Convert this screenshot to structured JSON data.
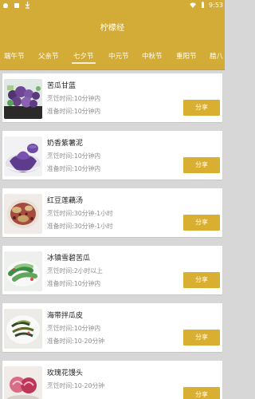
{
  "status_bar": {
    "time": "9:53"
  },
  "app": {
    "title": "柠檬经"
  },
  "tabs": [
    {
      "label": "端午节"
    },
    {
      "label": "父亲节"
    },
    {
      "label": "七夕节",
      "active": true
    },
    {
      "label": "中元节"
    },
    {
      "label": "中秋节"
    },
    {
      "label": "重阳节"
    },
    {
      "label": "腊八"
    }
  ],
  "recipes": [
    {
      "title": "苦瓜甘蓝",
      "cook_time": "烹饪时间:10分钟内",
      "prep_time": "准备时间:10分钟内",
      "share_label": "分享",
      "thumb_icon": "purple-cauliflower-photo"
    },
    {
      "title": "奶香紫薯泥",
      "cook_time": "烹饪时间:10分钟内",
      "prep_time": "准备时间:10分钟内",
      "share_label": "分享",
      "thumb_icon": "purple-mashed-potato-photo"
    },
    {
      "title": "红豆莲藕汤",
      "cook_time": "烹饪时间:30分钟-1小时",
      "prep_time": "准备时间:30分钟-1小时",
      "share_label": "分享",
      "thumb_icon": "red-bean-lotus-soup-photo"
    },
    {
      "title": "冰镇雪碧苦瓜",
      "cook_time": "烹饪时间:2小时以上",
      "prep_time": "准备时间:10分钟内",
      "share_label": "分享",
      "thumb_icon": "bitter-melon-photo"
    },
    {
      "title": "海带拌瓜皮",
      "cook_time": "烹饪时间:10分钟内",
      "prep_time": "准备时间:10-20分钟",
      "share_label": "分享",
      "thumb_icon": "kelp-salad-photo"
    },
    {
      "title": "玫瑰花馒头",
      "cook_time": "烹饪时间:10-20分钟",
      "prep_time": "",
      "share_label": "分享",
      "thumb_icon": "rose-bun-photo"
    }
  ],
  "colors": {
    "primary": "#d2ac37",
    "share_button": "#d9af32",
    "background": "#d7d7d7"
  }
}
